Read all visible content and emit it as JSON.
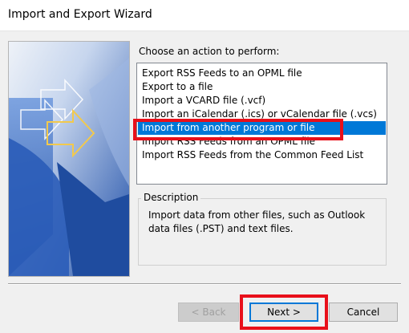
{
  "window": {
    "title": "Import and Export Wizard"
  },
  "prompt": {
    "label": "Choose an action to perform:"
  },
  "actions": [
    "Export RSS Feeds to an OPML file",
    "Export to a file",
    "Import a VCARD file (.vcf)",
    "Import an iCalendar (.ics) or vCalendar file (.vcs)",
    "Import from another program or file",
    "Import RSS Feeds from an OPML file",
    "Import RSS Feeds from the Common Feed List"
  ],
  "selected_index": 4,
  "description": {
    "legend": "Description",
    "text": "Import data from other files, such as Outlook data files (.PST) and text files."
  },
  "buttons": {
    "back": "< Back",
    "next": "Next >",
    "cancel": "Cancel"
  },
  "colors": {
    "selection": "#0078d7",
    "annotation": "#e8101a",
    "wizard_graphic": "#3a6fc7"
  }
}
